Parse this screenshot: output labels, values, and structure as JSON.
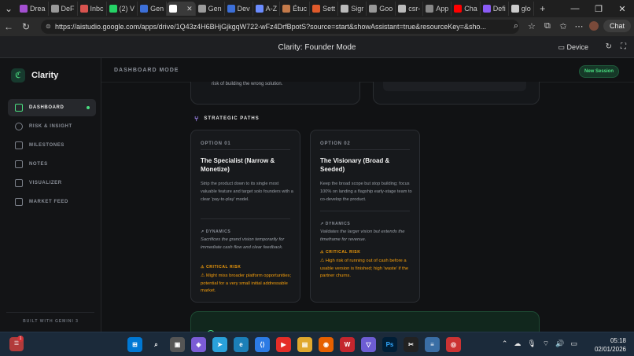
{
  "browser": {
    "tabs": [
      {
        "label": "Drea",
        "color": "#a34fd1"
      },
      {
        "label": "DeF",
        "color": "#999999"
      },
      {
        "label": "Inbc",
        "color": "#d9534f"
      },
      {
        "label": "(2) V",
        "color": "#25d366"
      },
      {
        "label": "Gen",
        "color": "#3c6fd8"
      },
      {
        "label": "",
        "color": "#ffffff"
      },
      {
        "label": "Gen",
        "color": "#9b9b9b"
      },
      {
        "label": "Dev",
        "color": "#3c6fd8"
      },
      {
        "label": "A-Z",
        "color": "#6b8cff"
      },
      {
        "label": "Étuc",
        "color": "#c47a4a"
      },
      {
        "label": "Sett",
        "color": "#e05a2b"
      },
      {
        "label": "Sigr",
        "color": "#bbbbbb"
      },
      {
        "label": "Goo",
        "color": "#999999"
      },
      {
        "label": "csr-",
        "color": "#bbbbbb"
      },
      {
        "label": "App",
        "color": "#888888"
      },
      {
        "label": "Cha",
        "color": "#ff0000"
      },
      {
        "label": "Defi",
        "color": "#8b5cf6"
      },
      {
        "label": "glo",
        "color": "#cccccc"
      }
    ],
    "close_glyph": "✕",
    "new_tab_glyph": "+",
    "url": "https://aistudio.google.com/apps/drive/1Q43z4H6BHjGjkgqW722-wFz4DrfBpotS?source=start&showAssistant=true&resourceKey=&sho...",
    "chat_label": "Chat"
  },
  "appbar": {
    "title": "Clarity: Founder Mode",
    "device_label": "Device"
  },
  "sidebar": {
    "brand": "Clarity",
    "items": [
      {
        "label": "DASHBOARD",
        "active": true
      },
      {
        "label": "RISK & INSIGHT"
      },
      {
        "label": "MILESTONES"
      },
      {
        "label": "NOTES"
      },
      {
        "label": "VISUALIZER"
      },
      {
        "label": "MARKET FEED"
      }
    ],
    "footer": "BUILT WITH GEMINI 3"
  },
  "main": {
    "mode": "DASHBOARD MODE",
    "new_session": "New Session",
    "prev_text": "risk of building the wrong solution.",
    "strategic_paths": "STRATEGIC PATHS",
    "options": [
      {
        "label": "OPTION 01",
        "title": "The Specialist (Narrow & Monetize)",
        "desc": "Strip the product down to its single most valuable feature and target solo founders with a clear 'pay-to-play' model.",
        "dynamics_label": "DYNAMICS",
        "dynamics": "Sacrifices the grand vision temporarily for immediate cash flow and clear feedback.",
        "risk_label": "CRITICAL RISK",
        "risk": "Might miss broader platform opportunities; potential for a very small initial addressable market."
      },
      {
        "label": "OPTION 02",
        "title": "The Visionary (Broad & Seeded)",
        "desc": "Keep the broad scope but stop building; focus 100% on landing a flagship early-stage team to co-develop the product.",
        "dynamics_label": "DYNAMICS",
        "dynamics": "Validates the larger vision but extends the timeframe for revenue.",
        "risk_label": "CRITICAL RISK",
        "risk": "High risk of running out of cash before a usable version is finished; high 'waste' if the partner churns."
      }
    ]
  },
  "taskbar": {
    "notification_count": "1",
    "time": "05:18",
    "date": "02/01/2026"
  }
}
